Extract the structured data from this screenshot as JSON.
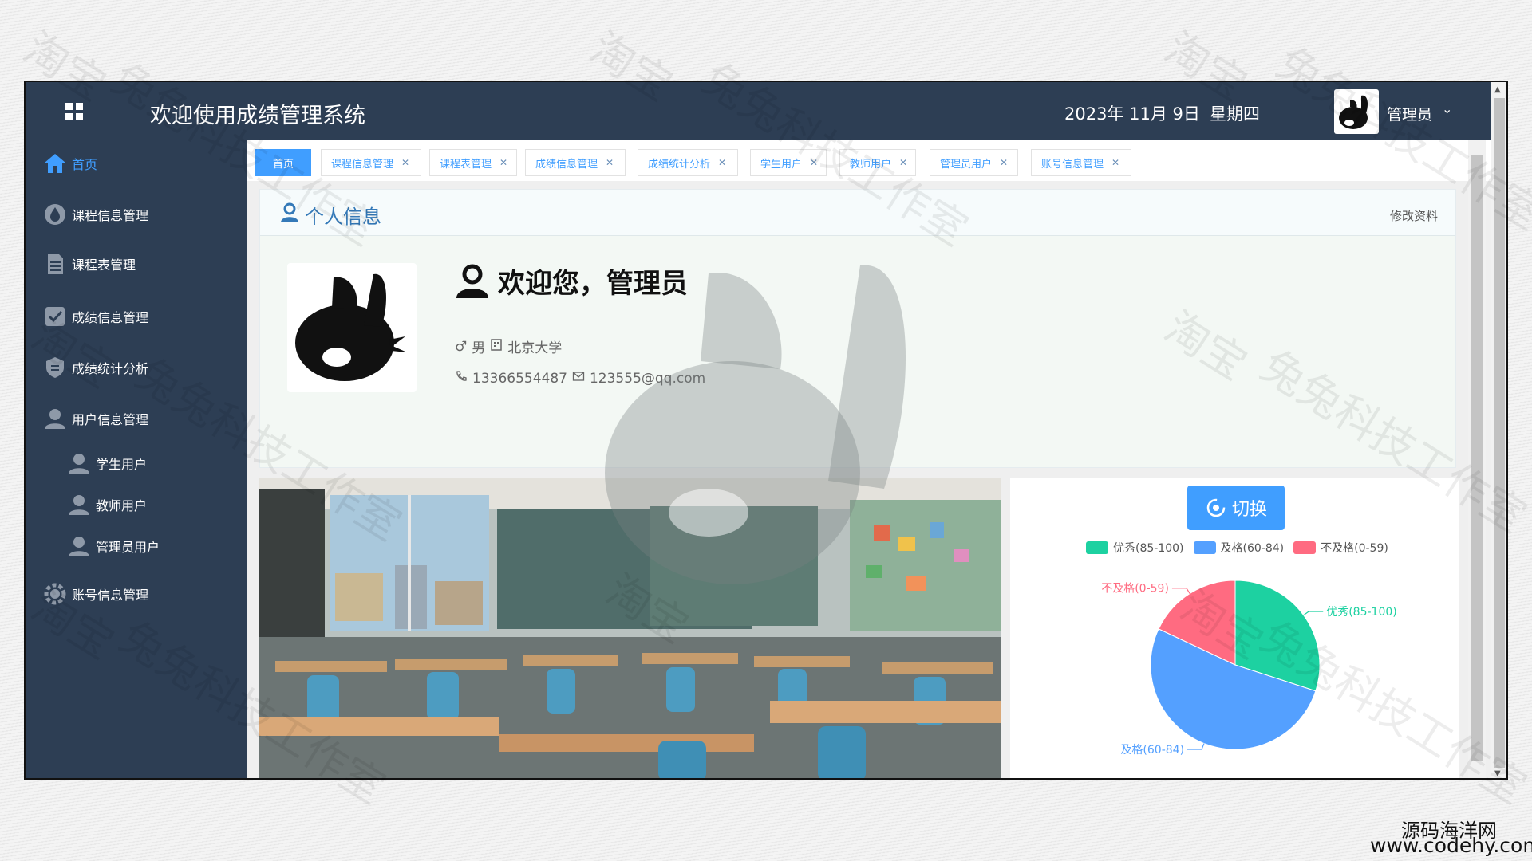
{
  "header": {
    "title": "欢迎使用成绩管理系统",
    "date": "2023年 11月 9日",
    "weekday": "星期四",
    "user_name": "管理员"
  },
  "sidebar": {
    "items": [
      {
        "label": "首页",
        "icon": "home-icon"
      },
      {
        "label": "课程信息管理",
        "icon": "drop-icon"
      },
      {
        "label": "课程表管理",
        "icon": "document-icon"
      },
      {
        "label": "成绩信息管理",
        "icon": "checkbox-icon"
      },
      {
        "label": "成绩统计分析",
        "icon": "shield-icon"
      },
      {
        "label": "用户信息管理",
        "icon": "user-icon"
      },
      {
        "label": "学生用户",
        "icon": "user-icon"
      },
      {
        "label": "教师用户",
        "icon": "user-icon"
      },
      {
        "label": "管理员用户",
        "icon": "user-icon"
      },
      {
        "label": "账号信息管理",
        "icon": "gear-icon"
      }
    ]
  },
  "tabs": [
    {
      "label": "首页",
      "active": true
    },
    {
      "label": "课程信息管理"
    },
    {
      "label": "课程表管理"
    },
    {
      "label": "成绩信息管理"
    },
    {
      "label": "成绩统计分析"
    },
    {
      "label": "学生用户"
    },
    {
      "label": "教师用户"
    },
    {
      "label": "管理员用户"
    },
    {
      "label": "账号信息管理"
    }
  ],
  "profile": {
    "section_title": "个人信息",
    "edit_label": "修改资料",
    "welcome": "欢迎您，管理员",
    "gender_symbol": "♂",
    "gender": "男",
    "school": "北京大学",
    "phone": "13366554487",
    "email": "123555@qq.com"
  },
  "chart_card": {
    "switch_label": "切换"
  },
  "chart_data": {
    "type": "pie",
    "categories": [
      "优秀(85-100)",
      "及格(60-84)",
      "不及格(0-59)"
    ],
    "values": [
      30,
      52,
      18
    ],
    "colors": [
      "#1dd1a1",
      "#54a0ff",
      "#ff6b81"
    ],
    "legend_position": "top"
  },
  "watermarks": [
    "淘宝",
    "兔兔科技工作室"
  ],
  "site_logo": {
    "line1": "源码海洋网",
    "line2": "www.codehy.com"
  },
  "colors": {
    "nav_bg": "#2d3e54",
    "accent": "#409eff"
  }
}
